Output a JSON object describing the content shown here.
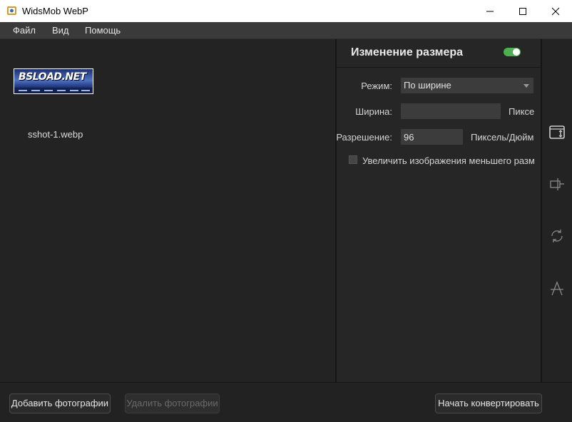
{
  "window": {
    "title": "WidsMob WebP",
    "controls": [
      "minimize-icon",
      "maximize-icon",
      "close-icon"
    ]
  },
  "menu": [
    "Файл",
    "Вид",
    "Помощь"
  ],
  "files": [
    {
      "thumbnail_text": "BSLOAD.NET",
      "name": "sshot-1.webp"
    }
  ],
  "settings": {
    "title": "Изменение размера",
    "enabled": true,
    "mode_label": "Режим:",
    "mode_value": "По ширине",
    "width_label": "Ширина:",
    "width_value": "",
    "width_unit": "Пиксе",
    "resolution_label": "Разрешение:",
    "resolution_value": "96",
    "resolution_unit": "Пиксель/Дюйм",
    "enlarge_label": "Увеличить изображения меньшего разм",
    "enlarge_checked": false
  },
  "tools": [
    "resize-icon",
    "crop-icon",
    "rotate-icon",
    "watermark-icon"
  ],
  "buttons": {
    "add": "Добавить фотографии",
    "remove": "Удалить фотографии",
    "convert": "Начать конвертировать"
  },
  "colors": {
    "toggle_on": "#4caf50",
    "background": "#222222",
    "panel": "#262626"
  }
}
